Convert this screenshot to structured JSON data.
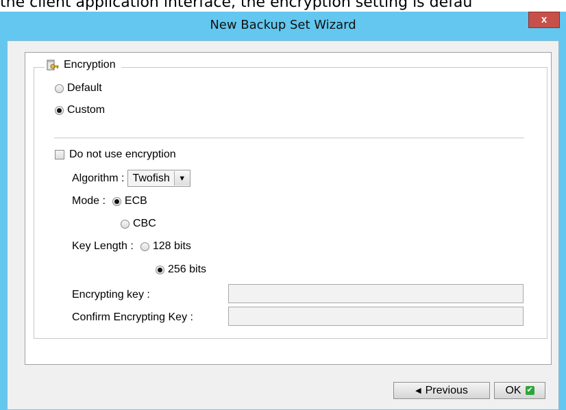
{
  "context_text": "the client application interface, the encryption setting is defau",
  "window": {
    "title": "New Backup Set Wizard",
    "close_label": "x"
  },
  "encryption": {
    "group_label": "Encryption",
    "default_label": "Default",
    "custom_label": "Custom",
    "selected_mode": "Custom",
    "no_encryption_label": "Do not use encryption",
    "no_encryption_checked": false,
    "algorithm_label": "Algorithm :",
    "algorithm_value": "Twofish",
    "mode_label": "Mode :",
    "mode_ecb": "ECB",
    "mode_cbc": "CBC",
    "mode_selected": "ECB",
    "key_length_label": "Key Length :",
    "key_128": "128 bits",
    "key_256": "256 bits",
    "key_selected": "256 bits",
    "encrypting_key_label": "Encrypting key :",
    "encrypting_key_value": "",
    "confirm_key_label": "Confirm Encrypting Key :",
    "confirm_key_value": ""
  },
  "footer": {
    "previous_label": "Previous",
    "ok_label": "OK"
  },
  "icons": {
    "encryption": "key-folder-icon",
    "previous": "left-triangle-icon",
    "ok": "green-check-icon",
    "dropdown": "triangle-down-icon"
  }
}
